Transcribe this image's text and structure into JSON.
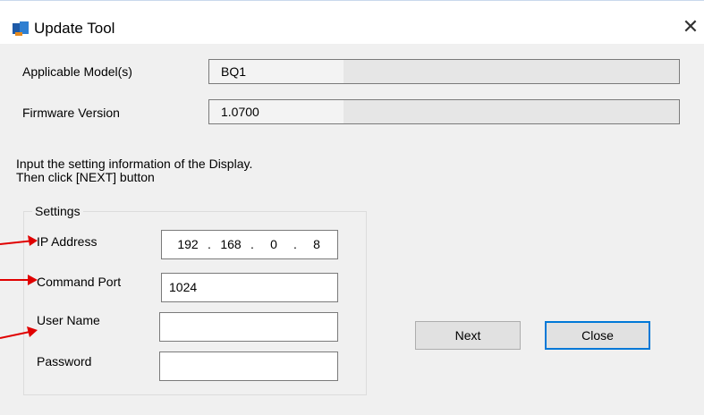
{
  "window": {
    "title": "Update Tool",
    "close_glyph": "✕"
  },
  "fields": {
    "applicable_models_label": "Applicable Model(s)",
    "applicable_models_value": "BQ1",
    "firmware_version_label": "Firmware Version",
    "firmware_version_value": "1.0700"
  },
  "instructions": {
    "line1": "Input the setting information of the Display.",
    "line2": "Then click [NEXT] button"
  },
  "settings": {
    "group_label": "Settings",
    "ip_label": "IP Address",
    "ip_octets": [
      "192",
      "168",
      "0",
      "8"
    ],
    "ip_sep": ".",
    "port_label": "Command Port",
    "port_value": "1024",
    "username_label": "User Name",
    "username_value": "",
    "password_label": "Password",
    "password_value": ""
  },
  "buttons": {
    "next": "Next",
    "close": "Close"
  },
  "colors": {
    "arrow": "#e00000",
    "focus": "#0078d7"
  },
  "icons": {
    "app": "app-icon",
    "close": "close-icon",
    "annotation": "red-arrow-icon"
  }
}
